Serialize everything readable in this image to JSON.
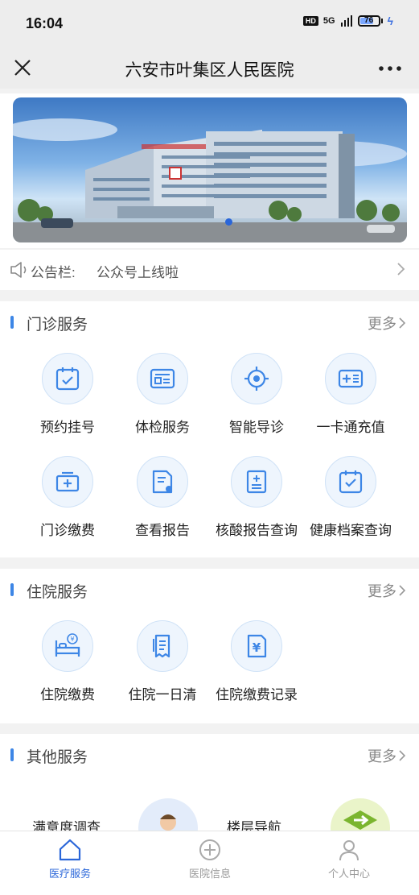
{
  "status_bar": {
    "time": "16:04",
    "hd": "HD",
    "network": "5G",
    "battery": "76",
    "battery_level_pct": 76
  },
  "header": {
    "title": "六安市叶集区人民医院"
  },
  "notice": {
    "label": "公告栏:",
    "text": "公众号上线啦"
  },
  "outpatient": {
    "title": "门诊服务",
    "more": "更多",
    "items": [
      {
        "label": "预约挂号",
        "icon": "calendar-check-icon"
      },
      {
        "label": "体检服务",
        "icon": "form-icon"
      },
      {
        "label": "智能导诊",
        "icon": "target-icon"
      },
      {
        "label": "一卡通充值",
        "icon": "card-plus-icon"
      },
      {
        "label": "门诊缴费",
        "icon": "medical-box-icon"
      },
      {
        "label": "查看报告",
        "icon": "report-search-icon"
      },
      {
        "label": "核酸报告查询",
        "icon": "test-report-icon"
      },
      {
        "label": "健康档案查询",
        "icon": "health-record-icon"
      }
    ]
  },
  "inpatient": {
    "title": "住院服务",
    "more": "更多",
    "items": [
      {
        "label": "住院缴费",
        "icon": "bed-payment-icon"
      },
      {
        "label": "住院一日清",
        "icon": "receipt-icon"
      },
      {
        "label": "住院缴费记录",
        "icon": "yuan-document-icon"
      }
    ]
  },
  "other": {
    "title": "其他服务",
    "more": "更多",
    "items": [
      {
        "label": "满意度调查"
      },
      {
        "label": "楼层导航"
      }
    ]
  },
  "tabs": [
    {
      "label": "医疗服务",
      "icon": "home-icon",
      "active": true
    },
    {
      "label": "医院信息",
      "icon": "plus-circle-icon",
      "active": false
    },
    {
      "label": "个人中心",
      "icon": "person-icon",
      "active": false
    }
  ],
  "colors": {
    "accent": "#2a66d9",
    "icon_blue": "#3d86e6",
    "icon_bg": "#eef5fd"
  }
}
